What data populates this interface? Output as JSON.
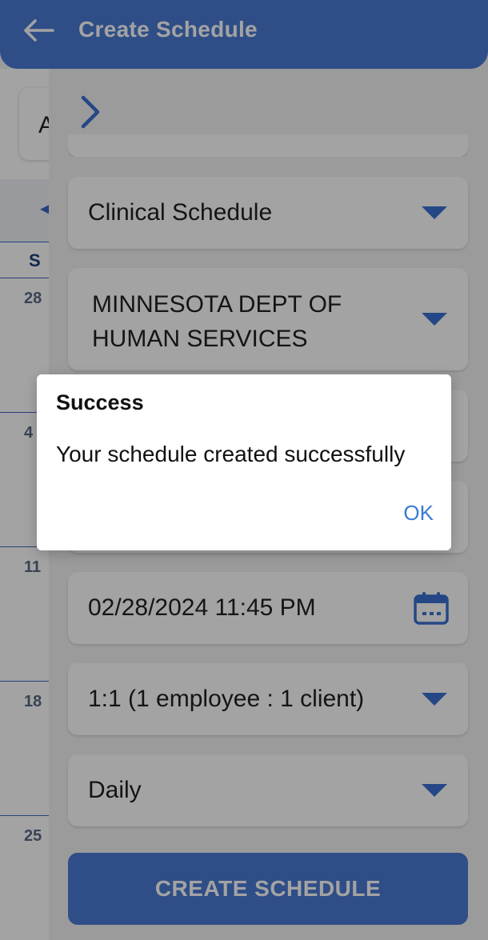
{
  "header": {
    "title": "Create Schedule",
    "back_icon": "arrow-left-icon"
  },
  "background": {
    "search_text": "A",
    "day_header": "S",
    "week_dates": [
      "28",
      "4",
      "11",
      "18",
      "25"
    ]
  },
  "drawer": {
    "toggle_icon": "chevron-right-icon",
    "fields": [
      {
        "value": "Clinical Schedule",
        "type": "dropdown"
      },
      {
        "value_lines": [
          "MINNESOTA DEPT OF",
          "HUMAN SERVICES"
        ],
        "type": "dropdown"
      },
      {
        "value": "02/28/2024 11:45 PM",
        "type": "datetime",
        "icon": "calendar-icon"
      },
      {
        "value": "1:1 (1 employee : 1 client)",
        "type": "dropdown"
      },
      {
        "value": "Daily",
        "type": "dropdown"
      }
    ],
    "create_button": "CREATE SCHEDULE"
  },
  "dialog": {
    "title": "Success",
    "message": "Your schedule created successfully",
    "ok_label": "OK"
  },
  "colors": {
    "accent": "#4a7ad4",
    "caret": "#3b6fd0",
    "ok_text": "#3a7bd5"
  }
}
